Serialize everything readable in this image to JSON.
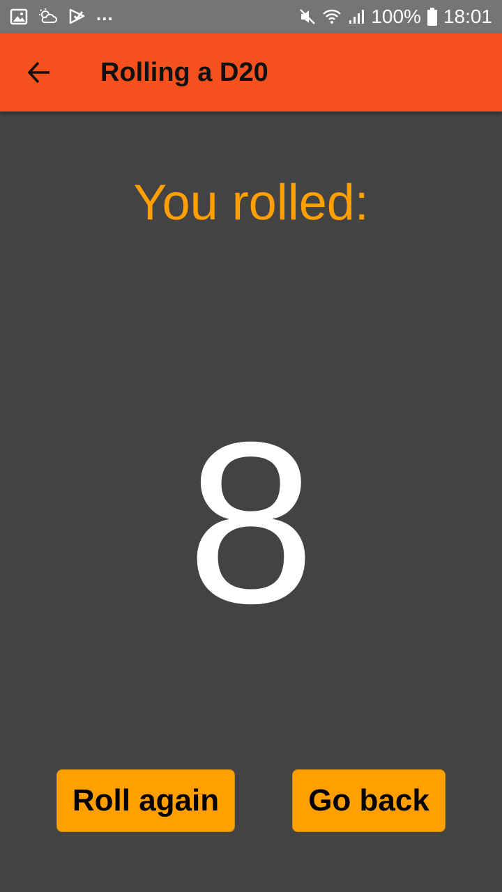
{
  "status_bar": {
    "battery": "100%",
    "time": "18:01",
    "overflow_indicator": "...",
    "left_icons": [
      "image-icon",
      "weather-icon",
      "play-store-icon"
    ],
    "right_icons": [
      "mute-icon",
      "wifi-icon",
      "signal-icon",
      "battery-icon"
    ]
  },
  "app_bar": {
    "title": "Rolling a D20",
    "back_icon": "arrow-back-icon",
    "color": "#f4511e"
  },
  "main": {
    "heading": "You rolled:",
    "result": "8",
    "heading_color": "#ffa000",
    "background": "#434343"
  },
  "actions": {
    "roll_again_label": "Roll again",
    "go_back_label": "Go back",
    "button_color": "#ffa000"
  }
}
